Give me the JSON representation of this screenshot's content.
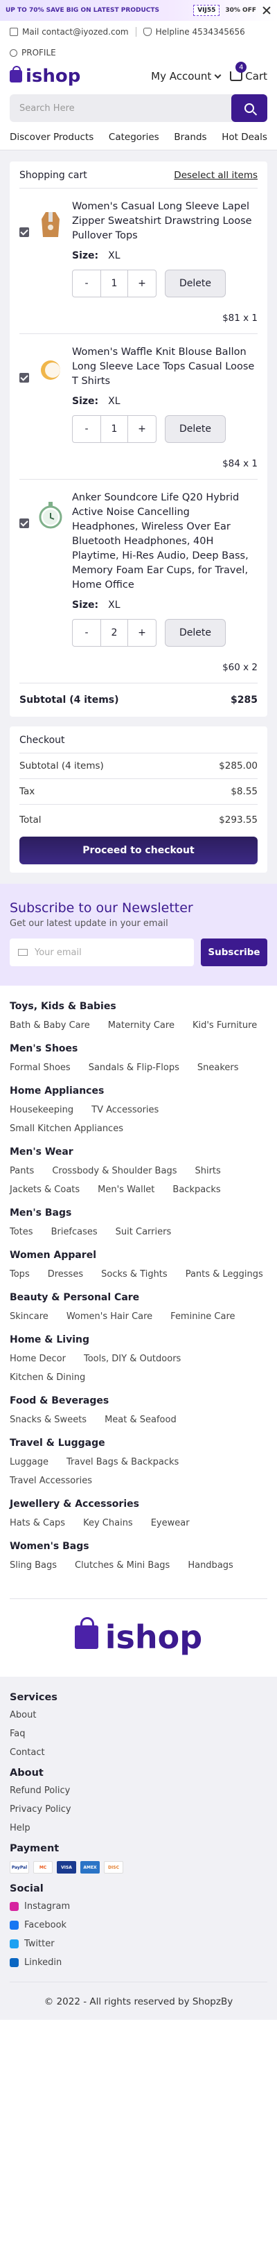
{
  "promo": {
    "left_text": "UP TO 70% SAVE BIG ON LATEST PRODUCTS",
    "code": "VIJ55",
    "off": "30% OFF"
  },
  "contact": {
    "email": "Mail contact@iyozed.com",
    "phone": "Helpline 4534345656",
    "profile": "PROFILE"
  },
  "header": {
    "logo": "ishop",
    "account": "My Account",
    "cart": "Cart",
    "cart_count": "4"
  },
  "search": {
    "placeholder": "Search Here"
  },
  "nav": [
    "Discover Products",
    "Categories",
    "Brands",
    "Hot Deals"
  ],
  "cart": {
    "title": "Shopping cart",
    "deselect": "Deselect all items",
    "size_label": "Size:",
    "delete_label": "Delete",
    "items": [
      {
        "title": "Women's Casual Long Sleeve Lapel Zipper Sweatshirt Drawstring Loose Pullover Tops",
        "size": "XL",
        "qty": "1",
        "price": "$81 x 1"
      },
      {
        "title": "Women's Waffle Knit Blouse Ballon Long Sleeve Lace Tops Casual Loose T Shirts",
        "size": "XL",
        "qty": "1",
        "price": "$84 x 1"
      },
      {
        "title": "Anker Soundcore Life Q20 Hybrid Active Noise Cancelling Headphones, Wireless Over Ear Bluetooth Headphones, 40H Playtime, Hi-Res Audio, Deep Bass, Memory Foam Ear Cups, for Travel, Home Office",
        "size": "XL",
        "qty": "2",
        "price": "$60 x 2"
      }
    ],
    "subtotal_label": "Subtotal (4 items)",
    "subtotal_value": "$285"
  },
  "checkout": {
    "title": "Checkout",
    "rows": [
      {
        "label": "Subtotal (4 items)",
        "value": "$285.00"
      },
      {
        "label": "Tax",
        "value": "$8.55"
      },
      {
        "label": "Total",
        "value": "$293.55"
      }
    ],
    "button": "Proceed to checkout"
  },
  "newsletter": {
    "title": "Subscribe to our Newsletter",
    "subtitle": "Get our latest update in your email",
    "placeholder": "Your email",
    "button": "Subscribe"
  },
  "categories": [
    {
      "title": "Toys, Kids & Babies",
      "links": [
        "Bath & Baby Care",
        "Maternity Care",
        "Kid's Furniture"
      ]
    },
    {
      "title": "Men's Shoes",
      "links": [
        "Formal Shoes",
        "Sandals & Flip-Flops",
        "Sneakers"
      ]
    },
    {
      "title": "Home Appliances",
      "links": [
        "Housekeeping",
        "TV Accessories",
        "Small Kitchen Appliances"
      ]
    },
    {
      "title": "Men's Wear",
      "links": [
        "Pants",
        "Crossbody & Shoulder Bags",
        "Shirts",
        "Jackets & Coats",
        "Men's Wallet",
        "Backpacks"
      ]
    },
    {
      "title": "Men's Bags",
      "links": [
        "Totes",
        "Briefcases",
        "Suit Carriers"
      ]
    },
    {
      "title": "Women Apparel",
      "links": [
        "Tops",
        "Dresses",
        "Socks & Tights",
        "Pants & Leggings"
      ]
    },
    {
      "title": "Beauty & Personal Care",
      "links": [
        "Skincare",
        "Women's Hair Care",
        "Feminine Care"
      ]
    },
    {
      "title": "Home & Living",
      "links": [
        "Home Decor",
        "Tools, DIY & Outdoors",
        "Kitchen & Dining"
      ]
    },
    {
      "title": "Food & Beverages",
      "links": [
        "Snacks & Sweets",
        "Meat & Seafood"
      ]
    },
    {
      "title": "Travel & Luggage",
      "links": [
        "Luggage",
        "Travel Bags & Backpacks",
        "Travel Accessories"
      ]
    },
    {
      "title": "Jewellery & Accessories",
      "links": [
        "Hats & Caps",
        "Key Chains",
        "Eyewear"
      ]
    },
    {
      "title": "Women's Bags",
      "links": [
        "Sling Bags",
        "Clutches & Mini Bags",
        "Handbags"
      ]
    }
  ],
  "footer": {
    "logo": "ishop",
    "services": {
      "title": "Services",
      "links": [
        "About",
        "Faq",
        "Contact"
      ]
    },
    "about": {
      "title": "About",
      "links": [
        "Refund Policy",
        "Privacy Policy",
        "Help"
      ]
    },
    "payment": {
      "title": "Payment",
      "methods": [
        {
          "name": "PayPal",
          "color": "#ffffff",
          "text": "#1a3a8f"
        },
        {
          "name": "MC",
          "color": "#ffffff",
          "text": "#eb5a1b"
        },
        {
          "name": "VISA",
          "color": "#1a3a8f",
          "text": "#ffffff"
        },
        {
          "name": "AMEX",
          "color": "#2a74c6",
          "text": "#ffffff"
        },
        {
          "name": "DISC",
          "color": "#ffffff",
          "text": "#e27c2a"
        }
      ]
    },
    "social": {
      "title": "Social",
      "links": [
        {
          "name": "Instagram",
          "color": "#d6249f"
        },
        {
          "name": "Facebook",
          "color": "#1877f2"
        },
        {
          "name": "Twitter",
          "color": "#1da1f2"
        },
        {
          "name": "Linkedin",
          "color": "#0a66c2"
        }
      ]
    },
    "copyright": "© 2022 - All rights reserved by ShopzBy"
  },
  "colors": {
    "brand": "#3c1a8f",
    "newsletter_bg": "#ece5fd"
  }
}
